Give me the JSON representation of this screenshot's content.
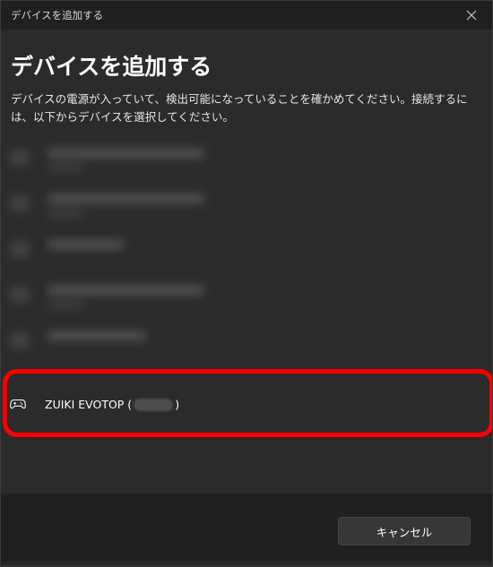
{
  "window": {
    "title": "デバイスを追加する"
  },
  "main": {
    "heading": "デバイスを追加する",
    "description": "デバイスの電源が入っていて、検出可能になっていることを確かめてください。接続するには、以下からデバイスを選択してください。"
  },
  "devices": {
    "highlighted": {
      "name_prefix": "ZUIKI EVOTOP (",
      "name_suffix": ")",
      "icon": "gamepad-icon"
    }
  },
  "footer": {
    "cancel_label": "キャンセル"
  },
  "colors": {
    "highlight": "#ff0000",
    "background": "#2b2b2b",
    "titlebar": "#202020"
  }
}
